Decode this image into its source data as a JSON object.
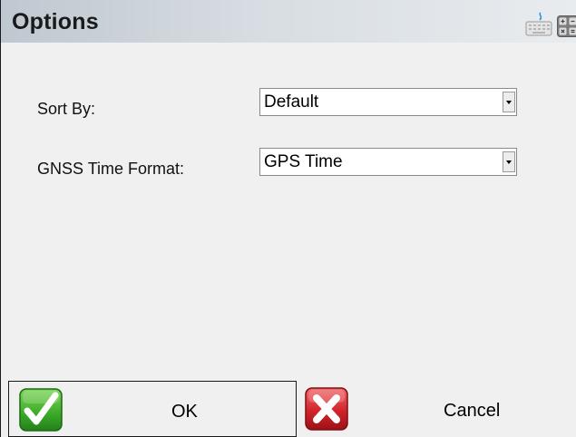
{
  "window": {
    "title": "Options"
  },
  "titlebar_icons": {
    "keyboard": "keyboard-icon",
    "calculator": "calculator-icon"
  },
  "form": {
    "sort_by": {
      "label": "Sort By:",
      "value": "Default"
    },
    "gnss_time_format": {
      "label": "GNSS Time Format:",
      "value": "GPS Time"
    }
  },
  "buttons": {
    "ok": {
      "label": "OK",
      "icon": "checkmark-icon"
    },
    "cancel": {
      "label": "Cancel",
      "icon": "x-close-icon"
    }
  },
  "colors": {
    "ok_green": "#3fae2a",
    "cancel_red": "#d2232a"
  }
}
